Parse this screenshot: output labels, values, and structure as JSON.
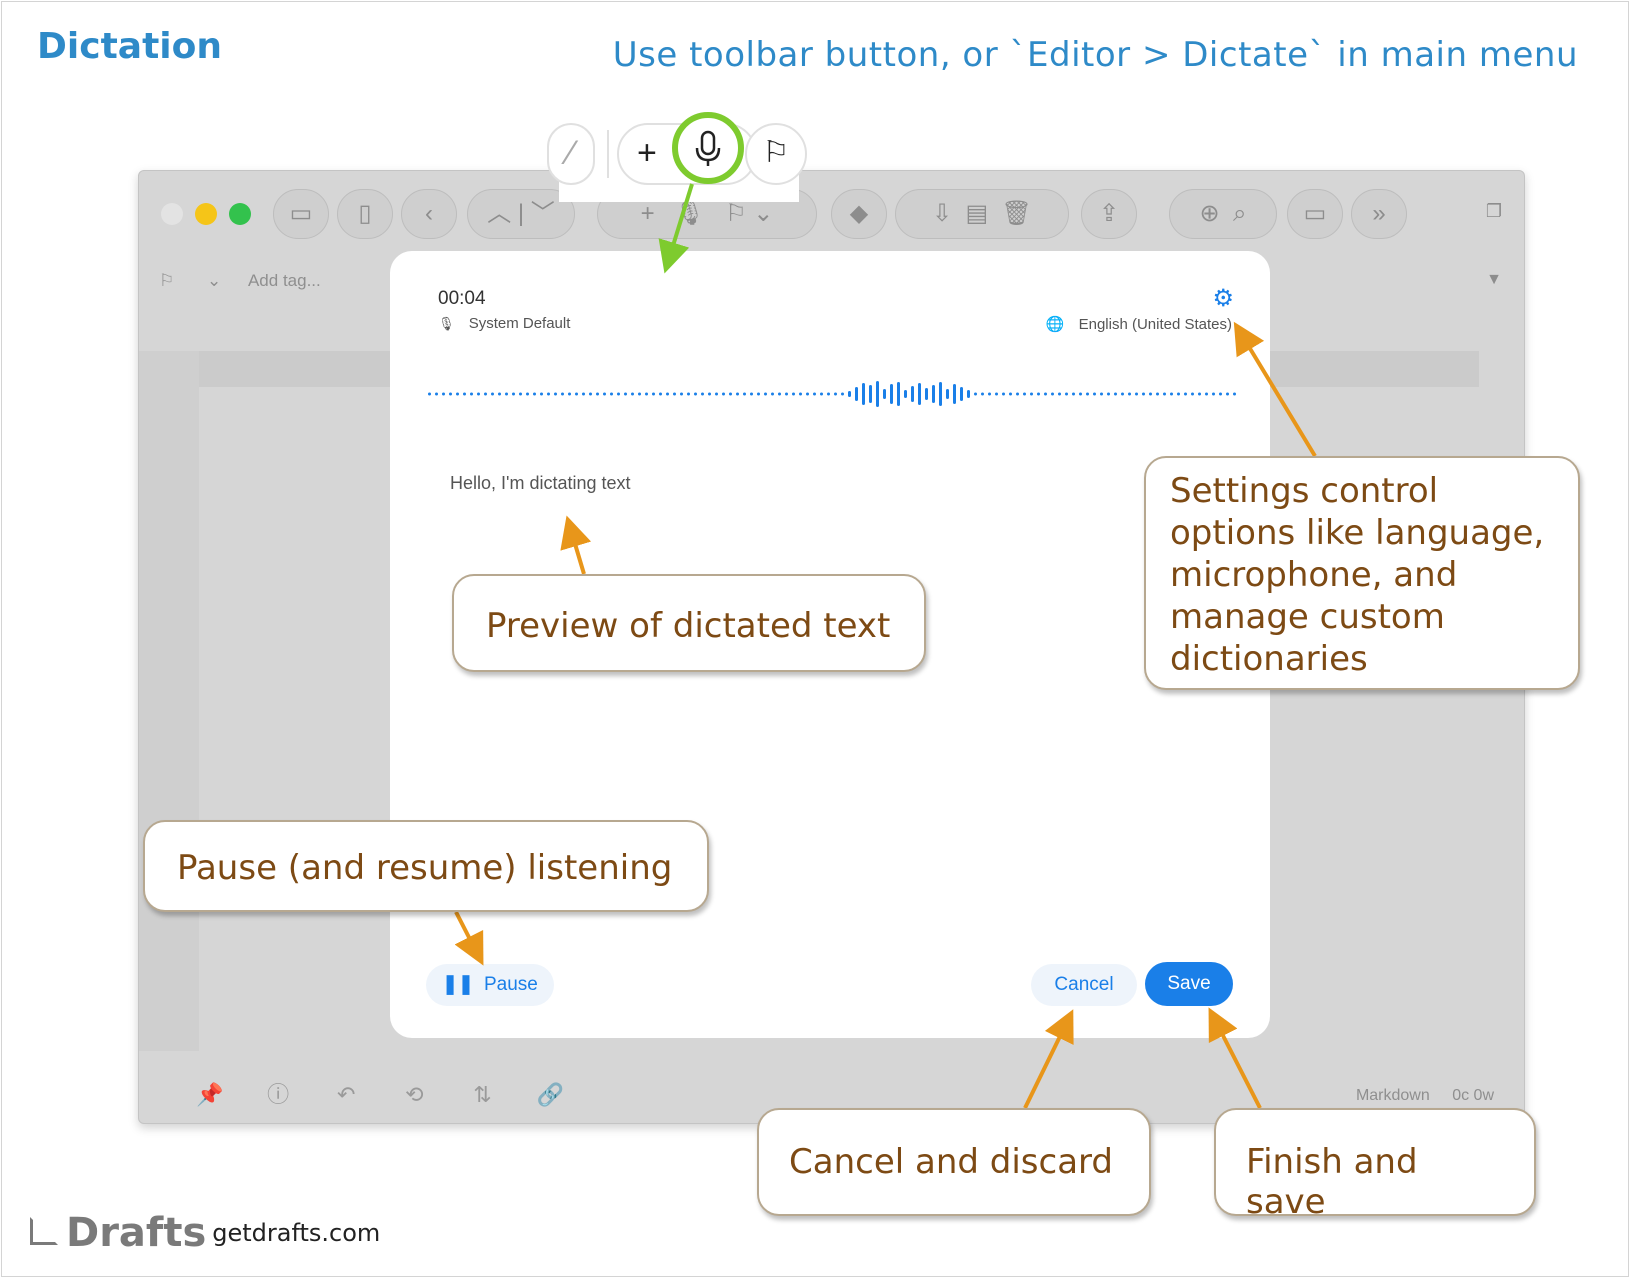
{
  "header": {
    "title": "Dictation",
    "subtitle": "Use toolbar button, or `Editor > Dictate` in main menu"
  },
  "window": {
    "add_tag_placeholder": "Add tag...",
    "status_mode": "Markdown",
    "status_counts": "0c 0w"
  },
  "dialog": {
    "timer": "00:04",
    "microphone": "System Default",
    "language": "English (United States)",
    "preview_text": "Hello, I'm dictating text",
    "pause_label": "Pause",
    "cancel_label": "Cancel",
    "save_label": "Save"
  },
  "callouts": {
    "preview": "Preview of dictated text",
    "settings": "Settings control options like language, microphone, and manage custom dictionaries",
    "pause": "Pause (and resume) listening",
    "cancel": "Cancel and discard",
    "save": "Finish and save"
  },
  "footer": {
    "brand": "Drafts",
    "site": "getdrafts.com"
  },
  "colors": {
    "accent_blue": "#1a7fe8",
    "title_blue": "#2e8ac8",
    "arrow_orange": "#e8961a",
    "ring_green": "#7ecb2e",
    "callout_text": "#7d4a14"
  },
  "icons": {
    "mic": "mic-icon",
    "gear": "gear-icon",
    "globe": "globe-icon",
    "pause": "pause-icon",
    "plus": "plus-icon",
    "flag": "flag-icon"
  }
}
